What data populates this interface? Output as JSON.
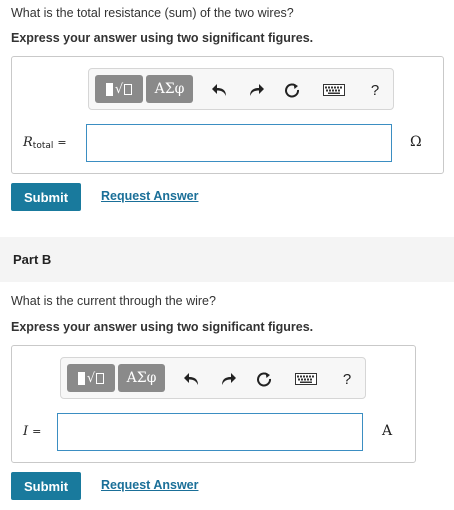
{
  "part_a": {
    "question": "What is the total resistance (sum) of the two wires?",
    "instruction": "Express your answer using two significant figures.",
    "toolbar": {
      "templates_label": "√",
      "symbols_label": "ΑΣφ",
      "undo_icon": "undo-icon",
      "redo_icon": "redo-icon",
      "reset_icon": "reset-icon",
      "keyboard_icon": "keyboard-icon",
      "help_label": "?"
    },
    "variable": "R",
    "variable_subscript": "total",
    "equals": "=",
    "input_value": "",
    "unit": "Ω",
    "submit_label": "Submit",
    "request_label": "Request Answer"
  },
  "part_b": {
    "title": "Part B",
    "question": "What is the current through the wire?",
    "instruction": "Express your answer using two significant figures.",
    "toolbar": {
      "templates_label": "√",
      "symbols_label": "ΑΣφ",
      "undo_icon": "undo-icon",
      "redo_icon": "redo-icon",
      "reset_icon": "reset-icon",
      "keyboard_icon": "keyboard-icon",
      "help_label": "?"
    },
    "variable": "I",
    "equals": "=",
    "input_value": "",
    "unit": "A",
    "submit_label": "Submit",
    "request_label": "Request Answer"
  },
  "colors": {
    "submit_bg": "#197a9d",
    "link": "#1a6f98",
    "input_border": "#3b8ec2",
    "toolbar_button": "#8a8a8a"
  }
}
